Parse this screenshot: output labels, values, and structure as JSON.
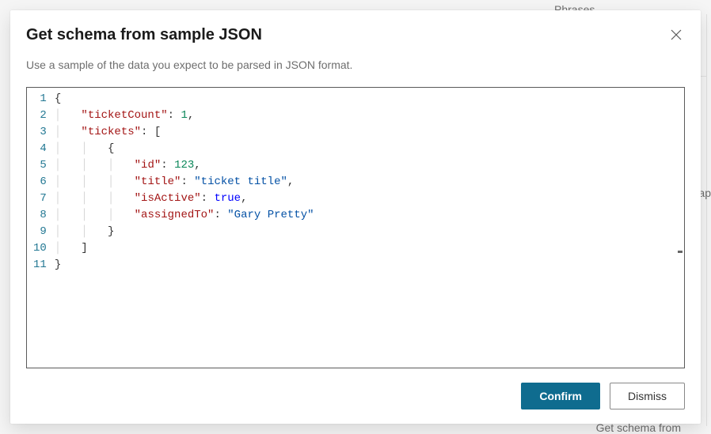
{
  "background": {
    "phrases": "Phrases",
    "ap": "ap",
    "getSchema": "Get schema from"
  },
  "modal": {
    "title": "Get schema from sample JSON",
    "subtitle": "Use a sample of the data you expect to be parsed in JSON format.",
    "confirm": "Confirm",
    "dismiss": "Dismiss"
  },
  "editor": {
    "lineCount": 11,
    "sampleJson": {
      "ticketCount": 1,
      "tickets": [
        {
          "id": 123,
          "title": "ticket title",
          "isActive": true,
          "assignedTo": "Gary Pretty"
        }
      ]
    },
    "tokens": {
      "l1": "{",
      "l2_key": "\"ticketCount\"",
      "l2_val": "1",
      "l3_key": "\"tickets\"",
      "l4": "{",
      "l5_key": "\"id\"",
      "l5_val": "123",
      "l6_key": "\"title\"",
      "l6_val": "\"ticket title\"",
      "l7_key": "\"isActive\"",
      "l7_val": "true",
      "l8_key": "\"assignedTo\"",
      "l8_val": "\"Gary Pretty\"",
      "l9": "}",
      "l10": "]",
      "l11": "}"
    }
  }
}
